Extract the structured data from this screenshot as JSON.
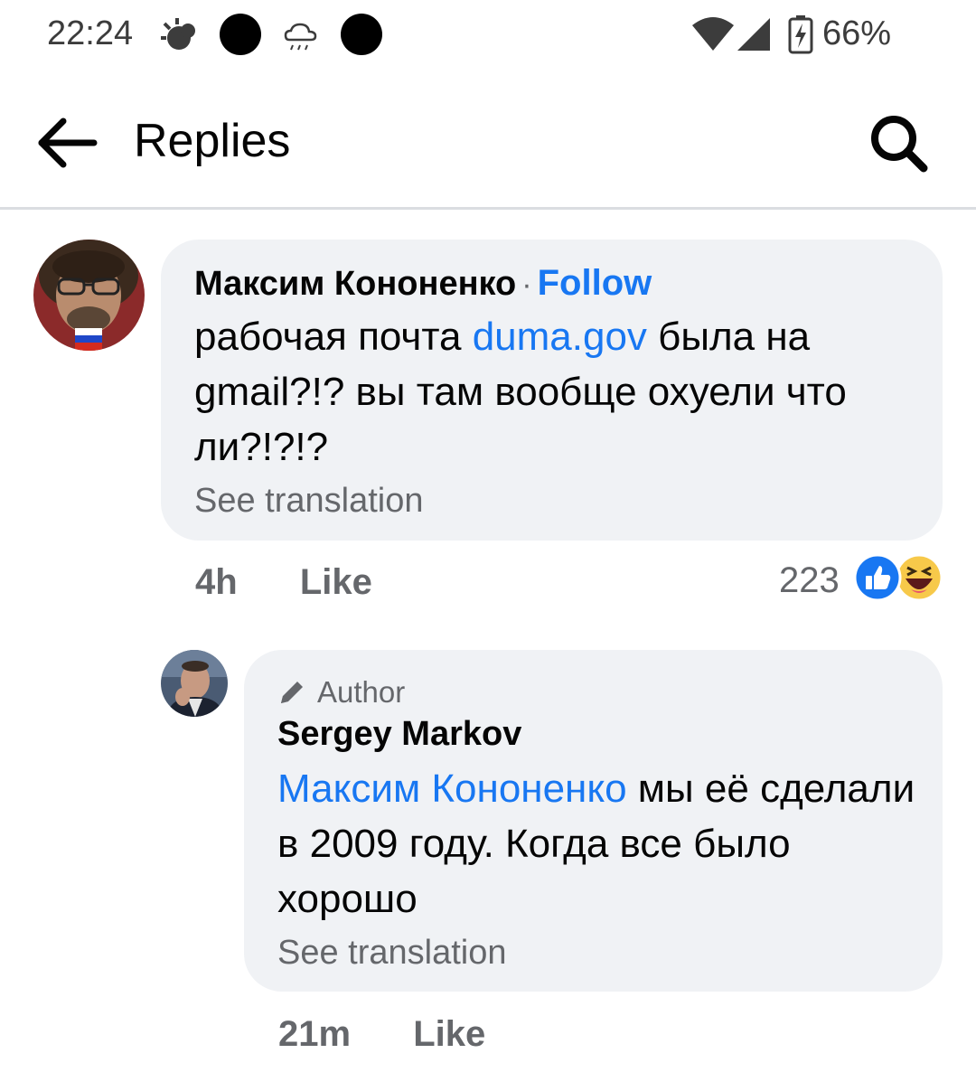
{
  "status_bar": {
    "time": "22:24",
    "battery": "66%",
    "icons": [
      "weather-icon",
      "notification-dot-icon",
      "cloud-rain-icon",
      "notification-dot-icon",
      "wifi-icon",
      "signal-icon",
      "battery-charging-icon"
    ]
  },
  "header": {
    "title": "Replies",
    "back_icon": "arrow-left-icon",
    "search_icon": "search-icon"
  },
  "comments": [
    {
      "author": "Максим Кононенко",
      "separator": "·",
      "follow_label": "Follow",
      "text_before": "рабочая почта ",
      "link_text": "duma.gov",
      "text_after": " была на gmail?!? вы там вообще охуели что ли?!?!?",
      "see_translation": "See translation",
      "time": "4h",
      "like_label": "Like",
      "reaction_count": "223",
      "reactions": [
        "like-reaction-icon",
        "haha-reaction-icon"
      ]
    },
    {
      "badge": "Author",
      "badge_icon": "pencil-icon",
      "author": "Sergey Markov",
      "mention": "Максим Кононенко",
      "text_after": " мы её сделали в 2009 году. Когда все было хорошо",
      "see_translation": "See translation",
      "time": "21m",
      "like_label": "Like"
    }
  ],
  "colors": {
    "accent": "#1877f2",
    "bubble": "#f0f2f5",
    "secondary_text": "#65676b"
  }
}
